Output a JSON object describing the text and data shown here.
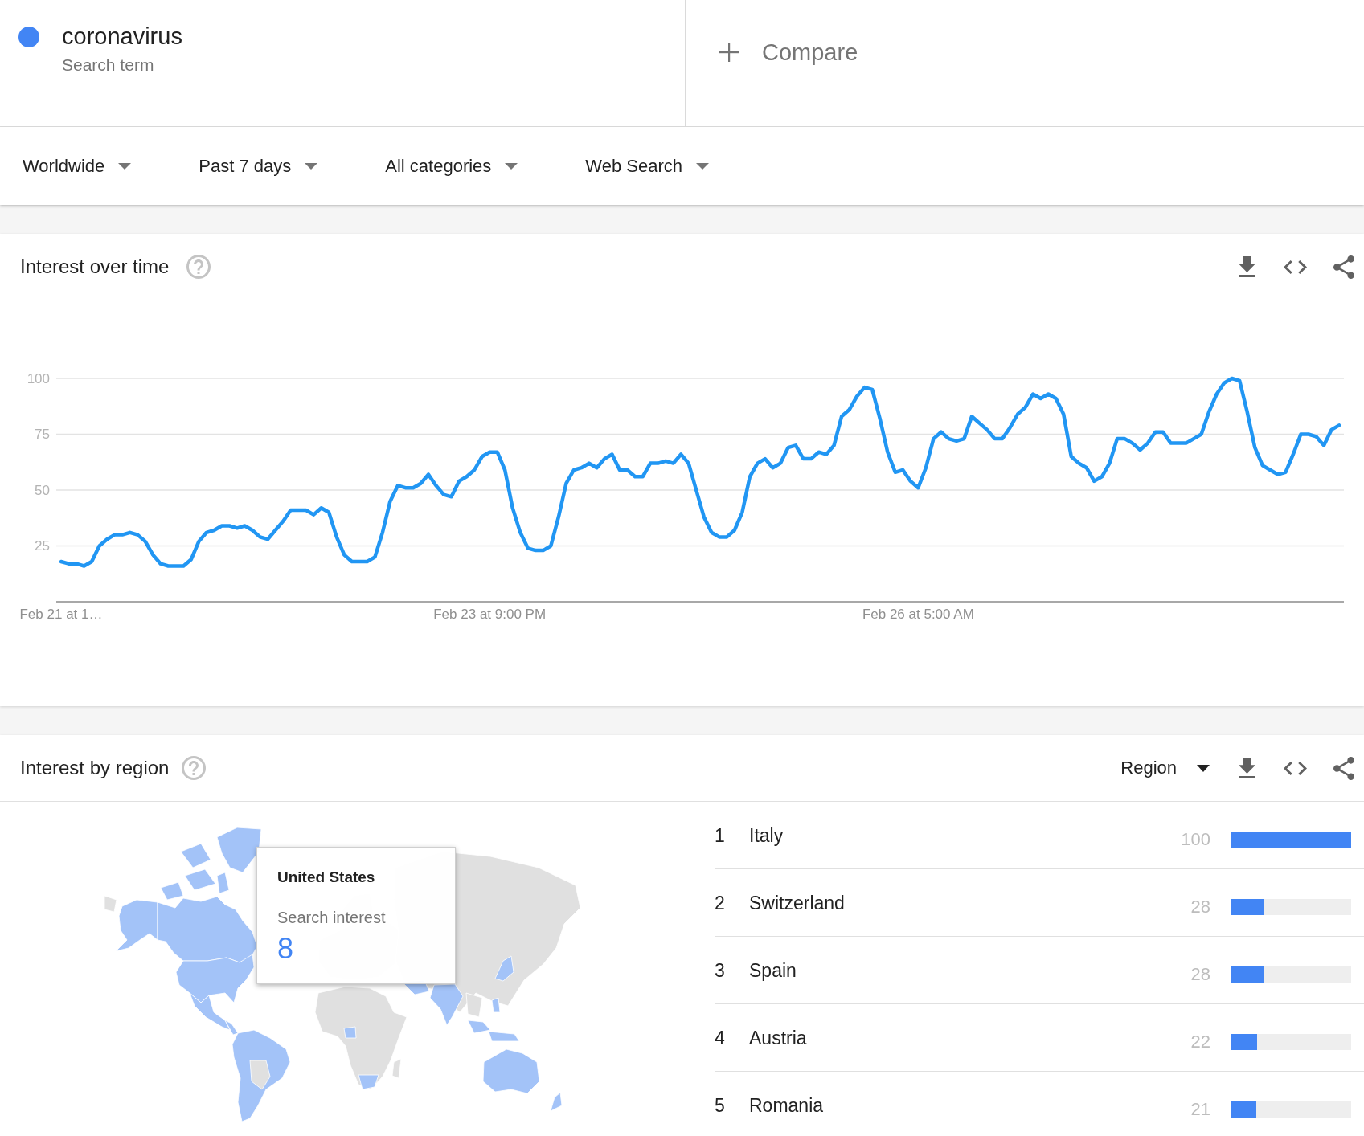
{
  "terms": [
    {
      "name": "coronavirus",
      "subtitle": "Search term",
      "color": "#4285f4"
    }
  ],
  "compare": {
    "label": "Compare"
  },
  "filters": [
    "Worldwide",
    "Past 7 days",
    "All categories",
    "Web Search"
  ],
  "interest_over_time": {
    "title": "Interest over time",
    "chart_data": {
      "type": "line",
      "grid": true,
      "ylim": [
        0,
        100
      ],
      "yticks": [
        25,
        50,
        75,
        100
      ],
      "categories": [
        "Feb 21 at 1…",
        null,
        null,
        null,
        null,
        null,
        null,
        null,
        null,
        null,
        null,
        null,
        null,
        null,
        null,
        null,
        null,
        null,
        null,
        null,
        null,
        null,
        null,
        null,
        null,
        null,
        null,
        null,
        null,
        null,
        null,
        null,
        null,
        null,
        null,
        null,
        null,
        null,
        null,
        null,
        null,
        null,
        null,
        null,
        null,
        null,
        null,
        null,
        null,
        null,
        null,
        null,
        null,
        null,
        null,
        null,
        "Feb 23 at 9:00 PM",
        null,
        null,
        null,
        null,
        null,
        null,
        null,
        null,
        null,
        null,
        null,
        null,
        null,
        null,
        null,
        null,
        null,
        null,
        null,
        null,
        null,
        null,
        null,
        null,
        null,
        null,
        null,
        null,
        null,
        null,
        null,
        null,
        null,
        null,
        null,
        null,
        null,
        null,
        null,
        null,
        null,
        null,
        null,
        null,
        null,
        null,
        null,
        null,
        null,
        null,
        null,
        null,
        null,
        null,
        null,
        "Feb 26 at 5:00 AM",
        null,
        null,
        null,
        null,
        null,
        null,
        null,
        null,
        null,
        null,
        null,
        null,
        null,
        null,
        null,
        null,
        null,
        null,
        null,
        null,
        null,
        null,
        null,
        null,
        null,
        null,
        null,
        null,
        null,
        null,
        null,
        null,
        null,
        null,
        null,
        null,
        null,
        null,
        null,
        null,
        null,
        null,
        null,
        null,
        null,
        null,
        null,
        null,
        null,
        null,
        null,
        null,
        null,
        null,
        null
      ],
      "values": [
        18,
        17,
        17,
        16,
        18,
        25,
        28,
        30,
        30,
        31,
        30,
        27,
        21,
        17,
        16,
        16,
        16,
        19,
        27,
        31,
        32,
        34,
        34,
        33,
        34,
        32,
        29,
        28,
        32,
        36,
        41,
        41,
        41,
        39,
        42,
        40,
        29,
        21,
        18,
        18,
        18,
        20,
        31,
        45,
        52,
        51,
        51,
        53,
        57,
        52,
        48,
        47,
        54,
        56,
        59,
        65,
        67,
        67,
        59,
        42,
        31,
        24,
        23,
        23,
        25,
        38,
        53,
        59,
        60,
        62,
        60,
        64,
        66,
        59,
        59,
        56,
        56,
        62,
        62,
        63,
        62,
        66,
        62,
        50,
        38,
        31,
        29,
        29,
        32,
        40,
        56,
        62,
        64,
        60,
        62,
        69,
        70,
        64,
        64,
        67,
        66,
        70,
        83,
        86,
        92,
        96,
        95,
        82,
        67,
        58,
        59,
        54,
        51,
        60,
        73,
        76,
        73,
        72,
        73,
        83,
        80,
        77,
        73,
        73,
        78,
        84,
        87,
        93,
        91,
        93,
        91,
        84,
        65,
        62,
        60,
        54,
        56,
        62,
        73,
        73,
        71,
        68,
        71,
        76,
        76,
        71,
        71,
        71,
        73,
        75,
        85,
        93,
        98,
        100,
        99,
        85,
        69,
        61,
        59,
        57,
        58,
        66,
        75,
        75,
        74,
        70,
        77,
        79
      ]
    }
  },
  "interest_by_region": {
    "title": "Interest by region",
    "resolution": "Region",
    "tooltip": {
      "title": "United States",
      "label": "Search interest",
      "value": "8"
    },
    "rows": [
      {
        "rank": "1",
        "name": "Italy",
        "value": "100",
        "level": 1.0
      },
      {
        "rank": "2",
        "name": "Switzerland",
        "value": "28",
        "level": 0.28
      },
      {
        "rank": "3",
        "name": "Spain",
        "value": "28",
        "level": 0.28
      },
      {
        "rank": "4",
        "name": "Austria",
        "value": "22",
        "level": 0.22
      },
      {
        "rank": "5",
        "name": "Romania",
        "value": "21",
        "level": 0.21
      }
    ]
  }
}
